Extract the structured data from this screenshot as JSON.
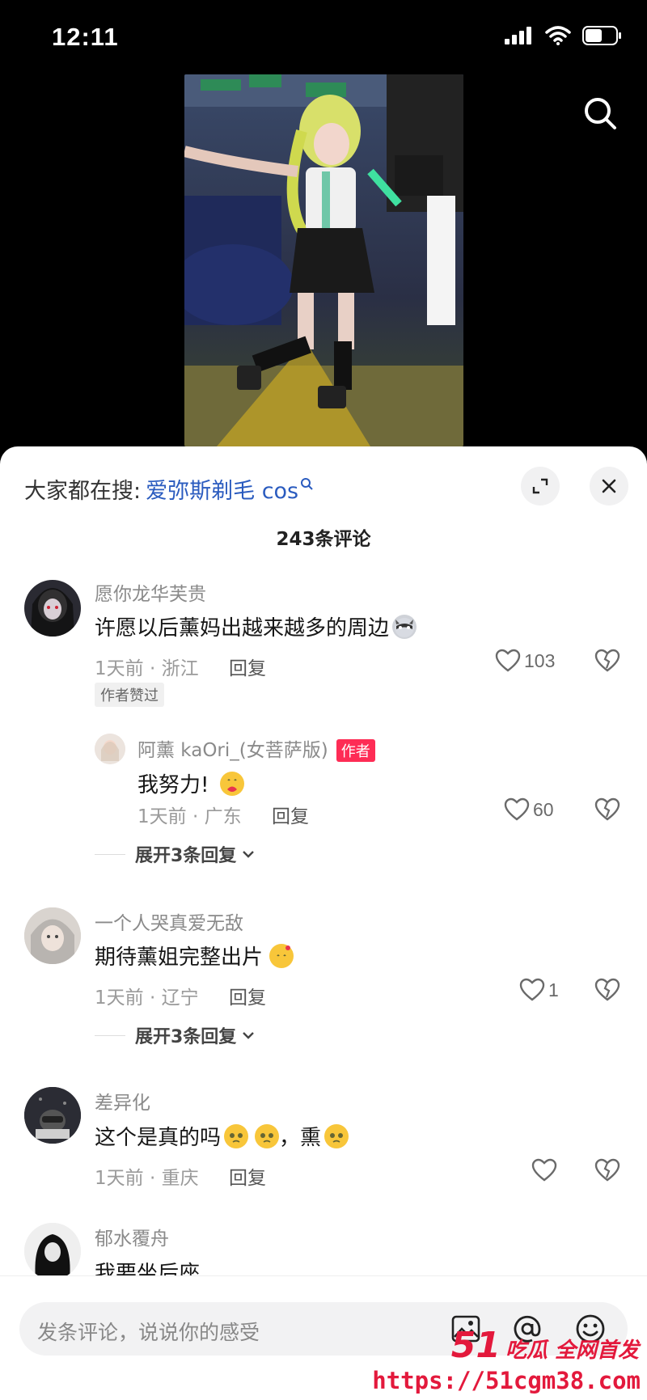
{
  "status": {
    "time": "12:11"
  },
  "sheet": {
    "trending_prefix": "大家都在搜:",
    "trending_term": "爱弥斯剃毛 cos",
    "comment_count": "243条评论"
  },
  "comments": [
    {
      "user": "愿你龙华芙贵",
      "text": "许愿以后薰妈出越来越多的周边",
      "emoji": "raccoon-emoji",
      "time_loc": "1天前 · 浙江",
      "reply_label": "回复",
      "likes": "103",
      "badge": "作者赞过"
    },
    {
      "user": "阿薰 kaOri_(女菩萨版)",
      "author_tag": "作者",
      "text": "我努力!",
      "emoji": "heart-hug-emoji",
      "time_loc": "1天前 · 广东",
      "reply_label": "回复",
      "likes": "60"
    },
    {
      "expand": "展开3条回复"
    },
    {
      "user": "一个人哭真爱无敌",
      "text": "期待薰姐完整出片",
      "emoji": "cat-heart-emoji",
      "time_loc": "1天前 · 辽宁",
      "reply_label": "回复",
      "likes": "1"
    },
    {
      "expand": "展开3条回复"
    },
    {
      "user": "差异化",
      "text_a": "这个是真的吗",
      "text_b": "，熏",
      "emoji": "pleading-face-emoji",
      "time_loc": "1天前 · 重庆",
      "reply_label": "回复",
      "likes": ""
    },
    {
      "user": "郁水覆舟",
      "text": "我要坐后座"
    }
  ],
  "input": {
    "placeholder": "发条评论，说说你的感受"
  },
  "watermark": {
    "num": "51",
    "text": "吃瓜 全网首发",
    "url": "https://51cgm38.com"
  },
  "colors": {
    "accent_red": "#fe2c55",
    "link_blue": "#2a5bbf",
    "watermark_red": "#e3193c"
  }
}
